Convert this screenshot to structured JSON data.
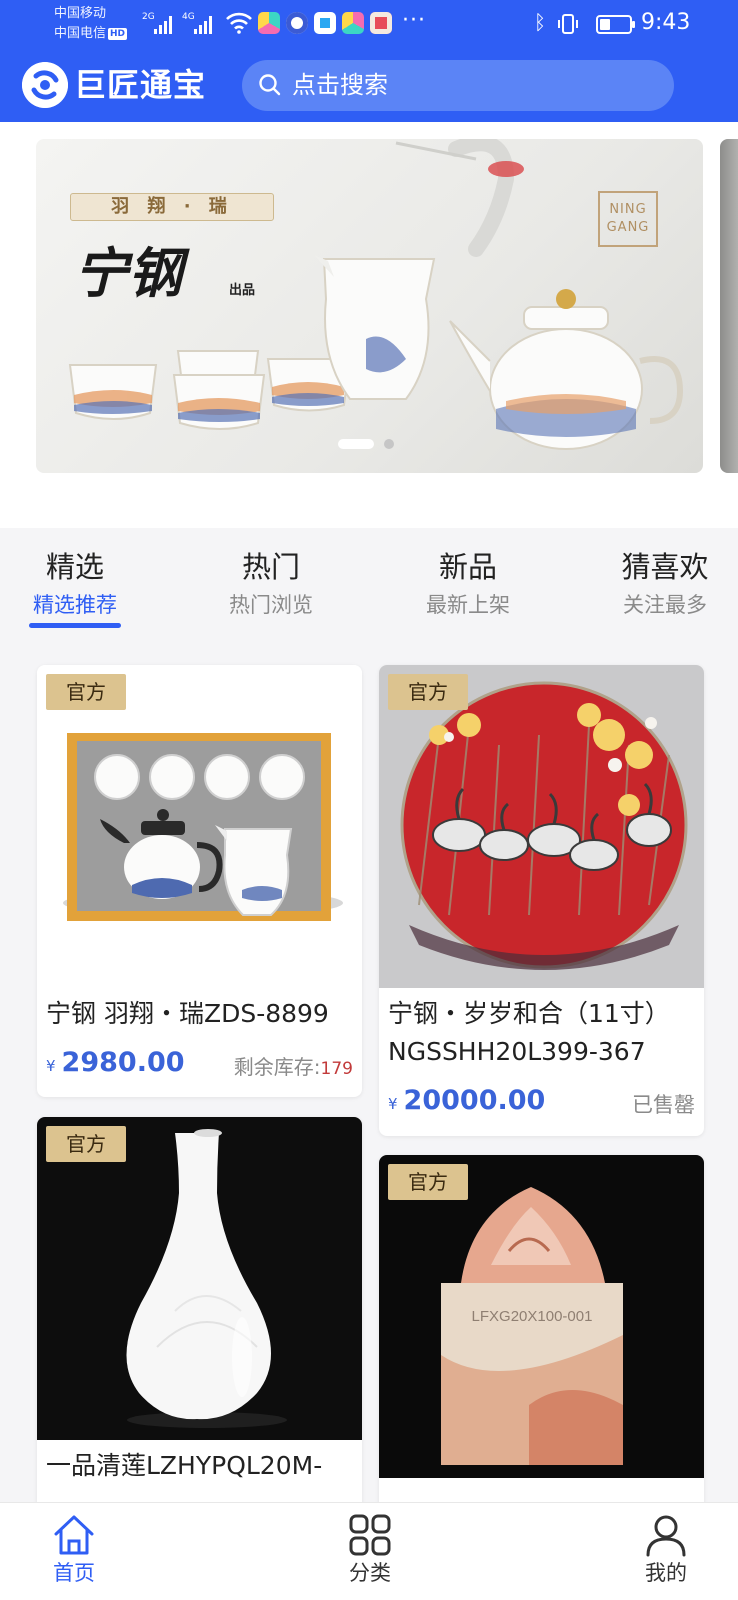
{
  "status_bar": {
    "carrier_1": "中国移动",
    "carrier_2": "中国电信",
    "hd_badge": "HD",
    "signal_1_label": "2G",
    "signal_2_label": "4G",
    "overflow": "···",
    "time": "9:43",
    "icons": [
      "wifi-icon",
      "app-icon",
      "app-icon",
      "app-icon",
      "app-icon",
      "app-icon",
      "bluetooth-icon",
      "vibrate-icon",
      "battery-icon"
    ]
  },
  "header": {
    "app_name": "巨匠通宝",
    "search_placeholder": "点击搜索",
    "accent_color": "#2f5ef4"
  },
  "banner": {
    "plaque_text": "羽 翔 · 瑞",
    "signature": "宁钢",
    "subtitle": "出品",
    "brand_line_1": "NING",
    "brand_line_2": "GANG",
    "slide_count": 2,
    "active_slide": 1
  },
  "tabs": [
    {
      "title": "精选",
      "subtitle": "精选推荐",
      "active": true
    },
    {
      "title": "热门",
      "subtitle": "热门浏览",
      "active": false
    },
    {
      "title": "新品",
      "subtitle": "最新上架",
      "active": false
    },
    {
      "title": "猜喜欢",
      "subtitle": "关注最多",
      "active": false
    }
  ],
  "products": [
    {
      "tag": "官方",
      "name": "宁钢 羽翔・瑞ZDS-8899",
      "currency": "¥",
      "price": "2980.00",
      "stock_label": "剩余库存:",
      "stock_value": "179"
    },
    {
      "tag": "官方",
      "name_line_1": "宁钢・岁岁和合（11寸）",
      "name_line_2": "NGSSHH20L399-367",
      "currency": "¥",
      "price": "20000.00",
      "status": "已售罄"
    },
    {
      "tag": "官方",
      "name": "一品清莲LZHYPQL20M-"
    },
    {
      "tag": "官方",
      "image_text": "LFXG20X100-001"
    }
  ],
  "bottom_nav": [
    {
      "label": "首页",
      "icon": "home-icon",
      "active": true
    },
    {
      "label": "分类",
      "icon": "grid-icon",
      "active": false
    },
    {
      "label": "我的",
      "icon": "user-icon",
      "active": false
    }
  ]
}
